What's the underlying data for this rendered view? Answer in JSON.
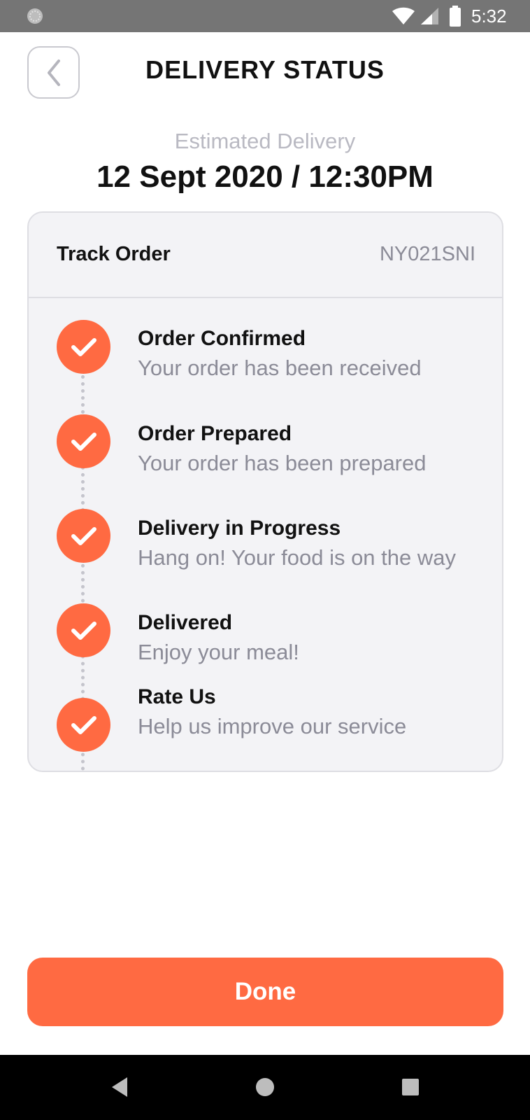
{
  "status_bar": {
    "time": "5:32",
    "icons": [
      "notification-dot-icon",
      "wifi-icon",
      "signal-icon",
      "battery-icon"
    ]
  },
  "header": {
    "title": "DELIVERY STATUS",
    "back_icon": "chevron-left-icon"
  },
  "eta": {
    "label": "Estimated Delivery",
    "value": "12 Sept 2020 / 12:30PM"
  },
  "tracking": {
    "title": "Track Order",
    "order_number": "NY021SNI",
    "steps": [
      {
        "title": "Order Confirmed",
        "description": "Your order has been received",
        "completed": true
      },
      {
        "title": "Order Prepared",
        "description": "Your order has been prepared",
        "completed": true
      },
      {
        "title": "Delivery in Progress",
        "description": "Hang on! Your food is on the way",
        "completed": true
      },
      {
        "title": "Delivered",
        "description": "Enjoy your meal!",
        "completed": true
      },
      {
        "title": "Rate Us",
        "description": "Help us improve our service",
        "completed": true
      }
    ]
  },
  "actions": {
    "done_label": "Done"
  },
  "nav_bar": {
    "icons": [
      "back-triangle-icon",
      "home-circle-icon",
      "recents-square-icon"
    ]
  },
  "colors": {
    "accent": "#ff6a42",
    "status_bar": "#757575",
    "card_background": "#f3f3f6",
    "muted_text": "#8b8b97"
  }
}
